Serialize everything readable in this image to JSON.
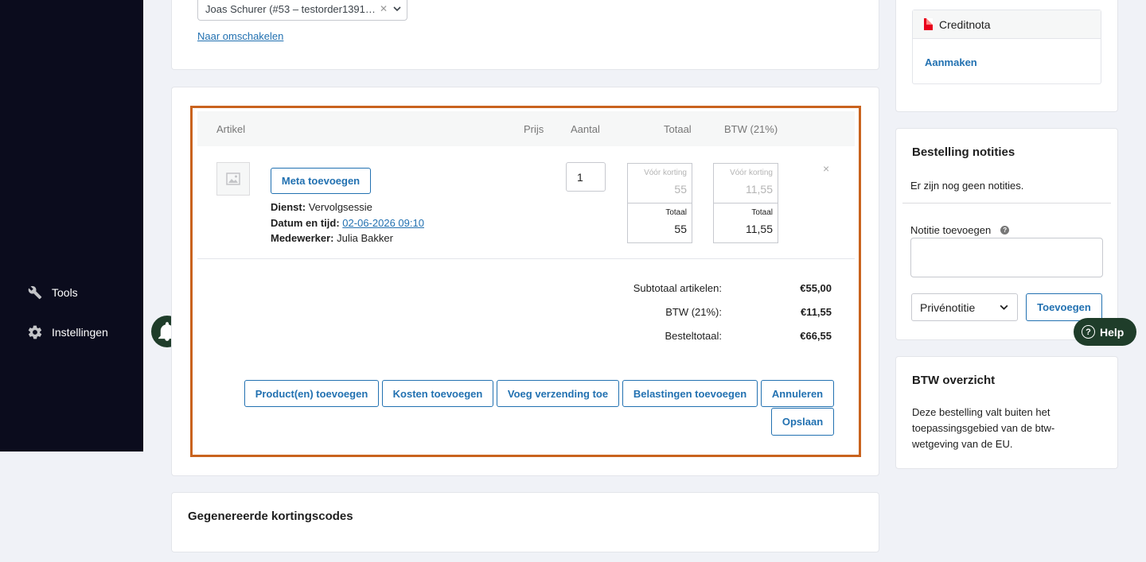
{
  "sidebar": {
    "items": [
      {
        "label": "Tools",
        "icon": "wrench-icon"
      },
      {
        "label": "Instellingen",
        "icon": "gear-icon"
      }
    ]
  },
  "customer": {
    "selected": "Joas Schurer (#53 – testorder1391…",
    "switch_link": "Naar omschakelen"
  },
  "items_table": {
    "headers": {
      "article": "Artikel",
      "price": "Prijs",
      "quantity": "Aantal",
      "total": "Totaal",
      "tax": "BTW (21%)"
    },
    "row": {
      "meta_button": "Meta toevoegen",
      "service_label": "Dienst:",
      "service_value": "Vervolgsessie",
      "datetime_label": "Datum en tijd:",
      "datetime_value": "02-06-2026 09:10",
      "employee_label": "Medewerker:",
      "employee_value": "Julia Bakker",
      "quantity": "1",
      "total_before_label": "Vóór korting",
      "total_before": "55",
      "total_label": "Totaal",
      "total": "55",
      "tax_before_label": "Vóór korting",
      "tax_before": "11,55",
      "tax_label": "Totaal",
      "tax": "11,55",
      "remove": "×"
    },
    "totals": {
      "subtotal_label": "Subtotaal artikelen:",
      "subtotal": "€55,00",
      "tax_label": "BTW (21%):",
      "tax": "€11,55",
      "order_total_label": "Besteltotaal:",
      "order_total": "€66,55"
    },
    "actions": {
      "add_products": "Product(en) toevoegen",
      "add_fees": "Kosten toevoegen",
      "add_shipping": "Voeg verzending toe",
      "add_taxes": "Belastingen toevoegen",
      "cancel": "Annuleren",
      "save": "Opslaan"
    }
  },
  "codes": {
    "title": "Gegenereerde kortingscodes"
  },
  "credit_note": {
    "title": "Creditnota",
    "create_link": "Aanmaken"
  },
  "notes": {
    "title": "Bestelling notities",
    "empty": "Er zijn nog geen notities.",
    "add_label": "Notitie toevoegen",
    "help": "?",
    "type_selected": "Privénotitie",
    "add_button": "Toevoegen"
  },
  "help_button": {
    "label": "Help",
    "glyph": "?"
  },
  "vat": {
    "title": "BTW overzicht",
    "text": "Deze bestelling valt buiten het toepassingsgebied van de btw-wetgeving van de EU."
  },
  "colors": {
    "sidebar": "#0b0c1d",
    "link": "#2271b1",
    "highlight": "#c9631e",
    "help": "#1f3d2a"
  }
}
